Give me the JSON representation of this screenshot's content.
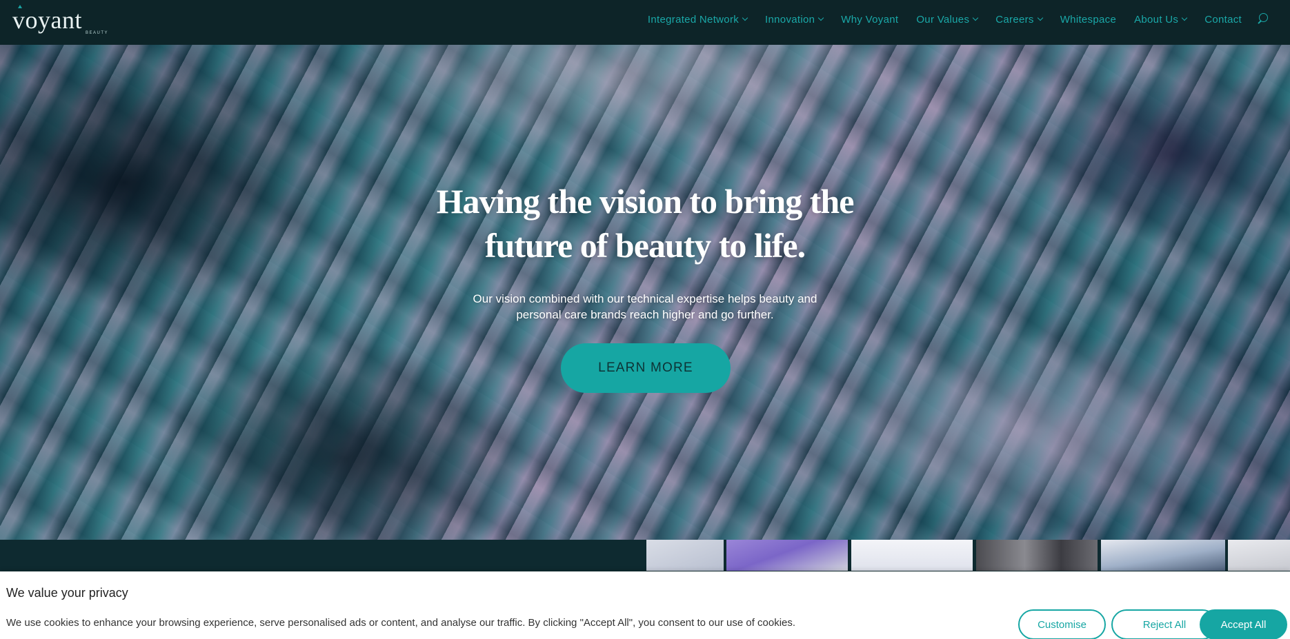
{
  "brand": {
    "name": "voyant",
    "tagline": "BEAUTY"
  },
  "nav": {
    "items": [
      {
        "label": "Integrated Network",
        "dropdown": true,
        "name": "nav-item-integrated-network"
      },
      {
        "label": "Innovation",
        "dropdown": true,
        "name": "nav-item-innovation"
      },
      {
        "label": "Why Voyant",
        "dropdown": false,
        "name": "nav-item-why-voyant"
      },
      {
        "label": "Our Values",
        "dropdown": true,
        "name": "nav-item-our-values"
      },
      {
        "label": "Careers",
        "dropdown": true,
        "name": "nav-item-careers"
      },
      {
        "label": "Whitespace",
        "dropdown": false,
        "name": "nav-item-whitespace"
      },
      {
        "label": "About Us",
        "dropdown": true,
        "name": "nav-item-about-us"
      },
      {
        "label": "Contact",
        "dropdown": false,
        "name": "nav-item-contact"
      }
    ],
    "search_icon": "search-icon"
  },
  "hero": {
    "title_line1": "Having the vision to bring the",
    "title_line2": "future of beauty to life.",
    "subtitle_line1": "Our vision combined with our technical expertise helps beauty and",
    "subtitle_line2": "personal care brands reach higher and go further.",
    "cta_label": "LEARN MORE"
  },
  "cookie": {
    "title": "We value your privacy",
    "text": "We use cookies to enhance your browsing experience, serve personalised ads or content, and analyse our traffic. By clicking \"Accept All\", you consent to our use of cookies.",
    "customise_label": "Customise",
    "reject_label": "Reject All",
    "accept_label": "Accept All"
  },
  "colors": {
    "header_bg": "#0d2428",
    "accent": "#16a6a3",
    "nav_text": "#1aa8a8"
  }
}
